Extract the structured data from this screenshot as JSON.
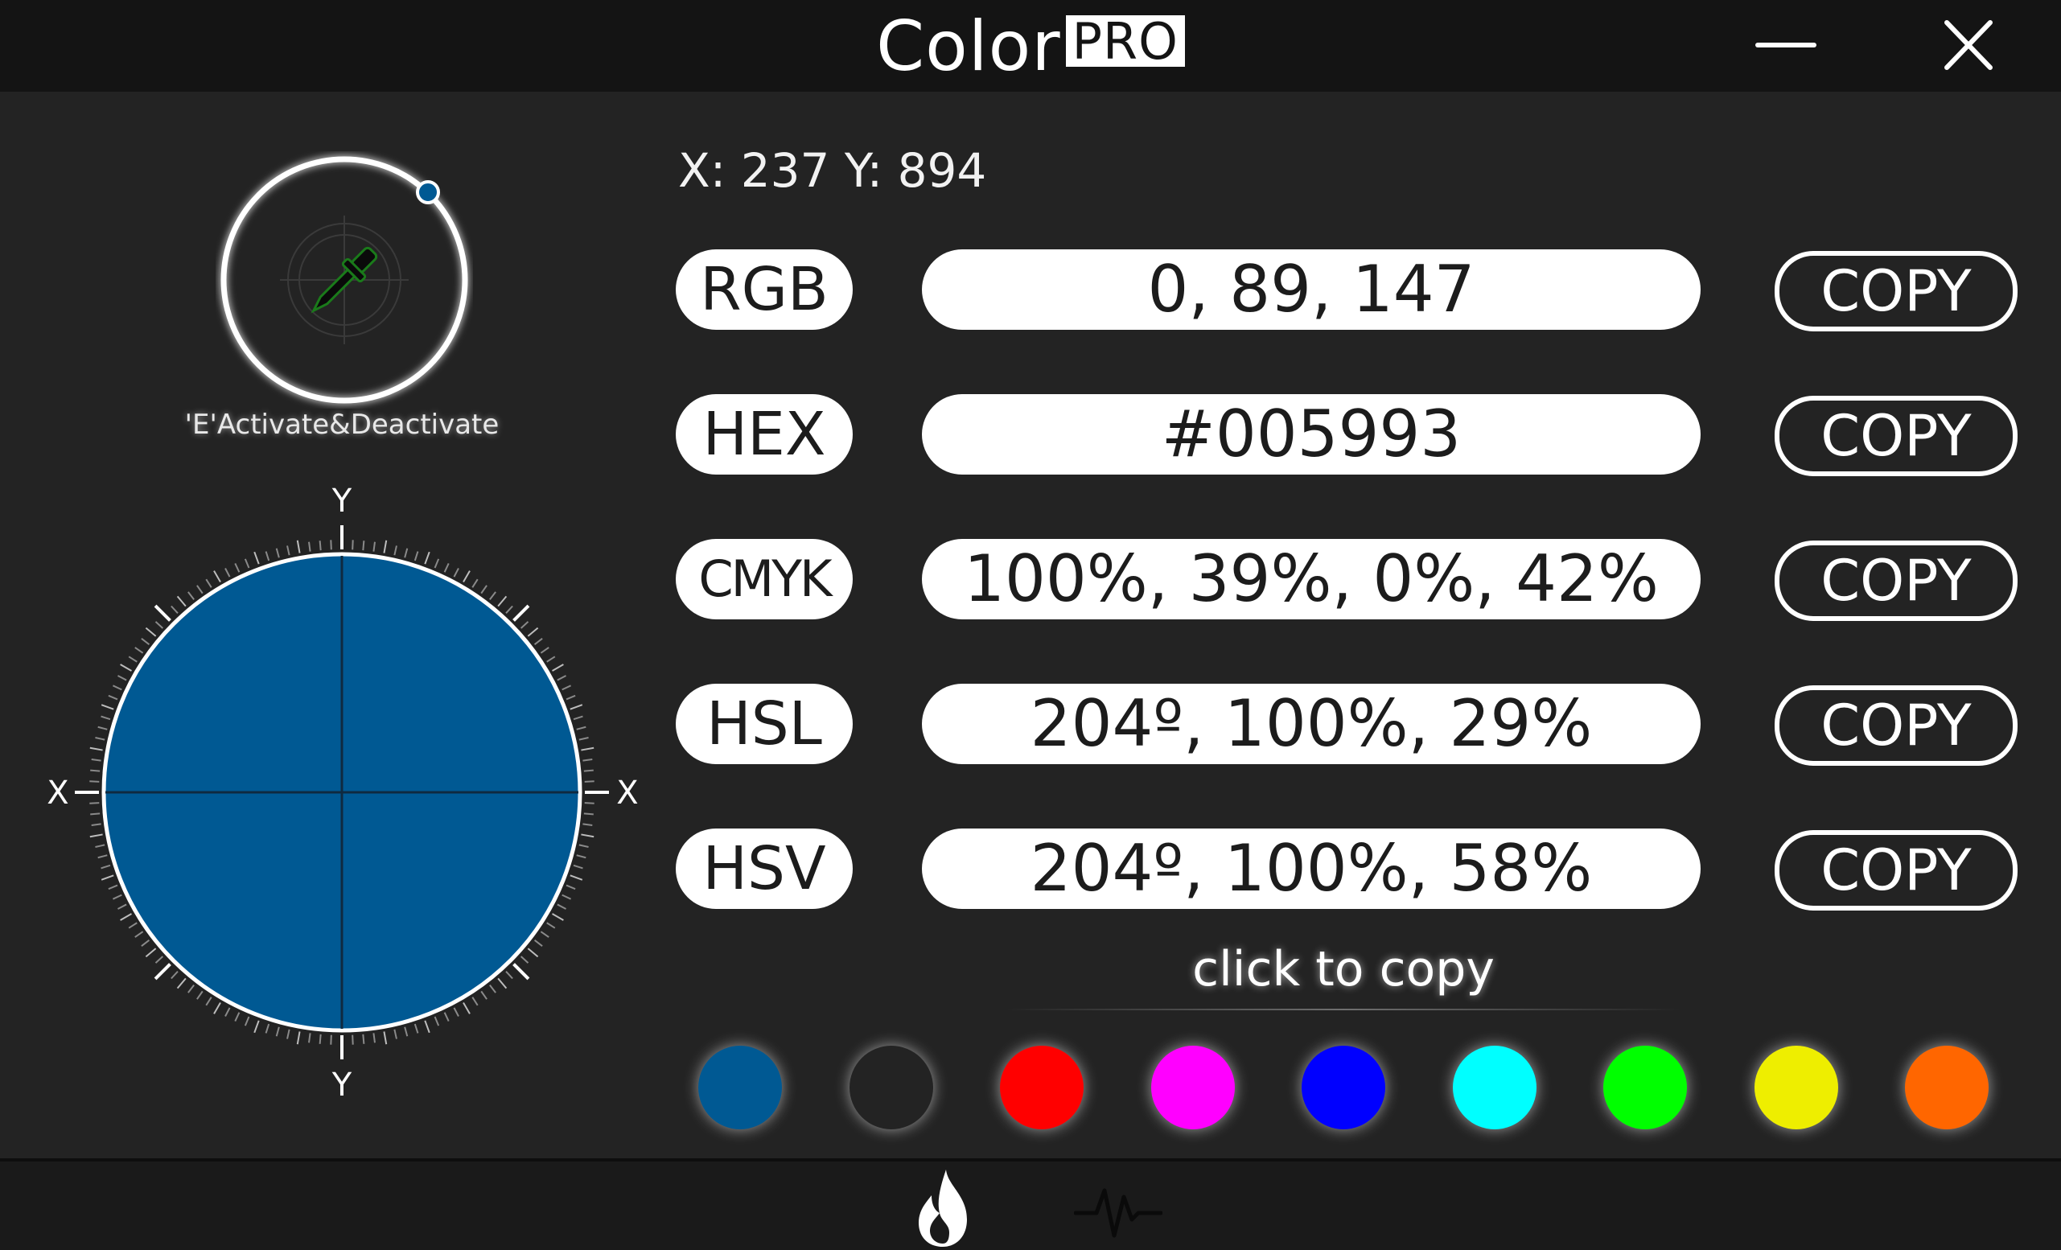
{
  "window": {
    "title": "Color",
    "title_badge": "PRO",
    "controls": [
      "minimize-icon",
      "close-icon"
    ]
  },
  "picker": {
    "icon": "eyedropper-icon",
    "hint": "'E'Activate&Deactivate",
    "compass_labels": {
      "top": "Y",
      "bottom": "Y",
      "left": "X",
      "right": "X"
    },
    "preview_color": "#005993"
  },
  "coords": {
    "x_label": "X:",
    "x": "237",
    "y_label": "Y:",
    "y": "894"
  },
  "formats": [
    {
      "label": "RGB",
      "value": "0, 89, 147",
      "copy_label": "COPY"
    },
    {
      "label": "HEX",
      "value": "#005993",
      "copy_label": "COPY"
    },
    {
      "label": "CMYK",
      "value": "100%, 39%, 0%, 42%",
      "copy_label": "COPY"
    },
    {
      "label": "HSL",
      "value": "204º, 100%, 29%",
      "copy_label": "COPY"
    },
    {
      "label": "HSV",
      "value": "204º, 100%, 58%",
      "copy_label": "COPY"
    }
  ],
  "history": {
    "hint": "click to copy",
    "swatches": [
      "#005993",
      "#232323",
      "#ff0000",
      "#ff00ff",
      "#0000ff",
      "#00ffff",
      "#00ff00",
      "#eeee00",
      "#ff6600"
    ]
  },
  "bottom_tabs": [
    "flame-icon",
    "pulse-icon"
  ],
  "colors": {
    "accent": "#005993",
    "background": "#232323",
    "titlebar": "#141414"
  }
}
